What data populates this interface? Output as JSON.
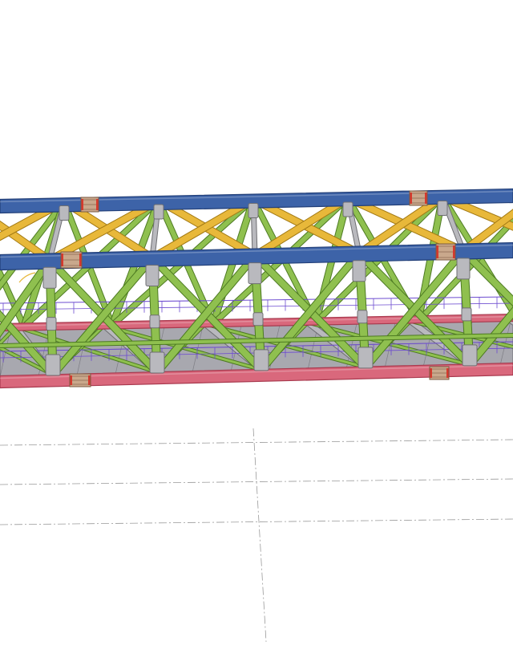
{
  "colors": {
    "background": "#ffffff",
    "top_chord": "#3d63a8",
    "top_chord_edge": "#223f78",
    "bottom_chord": "#d9687c",
    "bottom_chord_edge": "#a8394e",
    "top_bracing": "#e8b83a",
    "top_bracing_edge": "#a37a14",
    "web_member": "#8fc04f",
    "web_member_edge": "#4d7a22",
    "gusset_node": "#b9b9be",
    "gusset_edge": "#6e6e72",
    "deck": "#9e9ea6",
    "deck_edge": "#6c6c74",
    "railing": "#6c4bd0",
    "splice_plate": "#c9a88c",
    "splice_bolt": "#d6392e",
    "grid_line": "#9a9a9a"
  },
  "icons": {
    "truss": "truss-bridge-icon",
    "splice": "splice-plate-icon"
  },
  "model": {
    "object": "steel-truss-bridge-3d-model",
    "panels_visible": 6,
    "has_railings": true,
    "has_deck": true
  }
}
